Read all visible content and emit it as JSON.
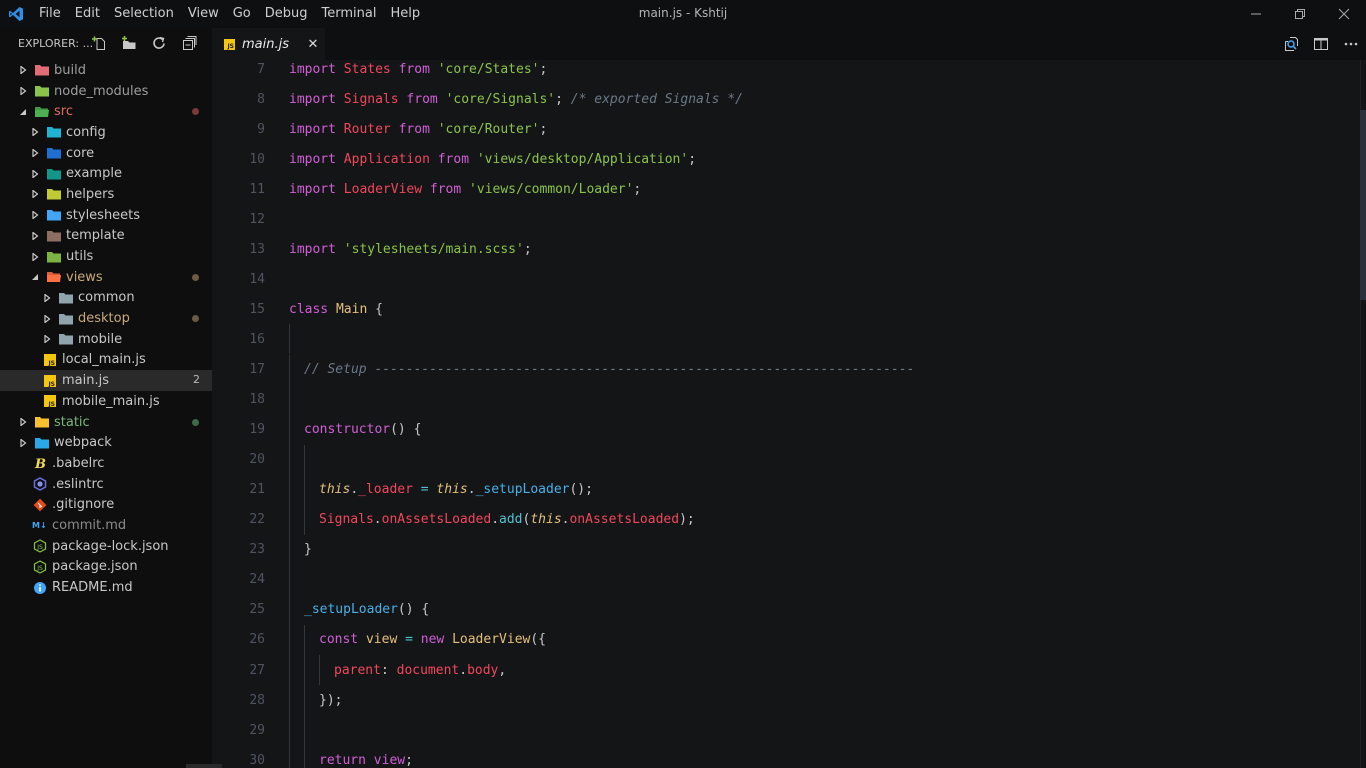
{
  "window": {
    "title": "main.js - Kshtij",
    "menu": [
      "File",
      "Edit",
      "Selection",
      "View",
      "Go",
      "Debug",
      "Terminal",
      "Help"
    ]
  },
  "sidebar": {
    "title": "EXPLORER: ...",
    "actions": [
      "new-file",
      "new-folder",
      "refresh",
      "collapse-all"
    ],
    "tree": [
      {
        "label": "build",
        "depth": 0,
        "kind": "folder",
        "expanded": false,
        "icon_color": "#e06c75",
        "label_color": "#9e9e9e"
      },
      {
        "label": "node_modules",
        "depth": 0,
        "kind": "folder",
        "expanded": false,
        "icon_color": "#8bc34a",
        "label_color": "#9e9e9e"
      },
      {
        "label": "src",
        "depth": 0,
        "kind": "folder",
        "expanded": true,
        "icon_color": "#4caf50",
        "label_color": "#e36a5e",
        "badge_color": "#7a3b38"
      },
      {
        "label": "config",
        "depth": 1,
        "kind": "folder",
        "expanded": false,
        "icon_color": "#1eb3cf"
      },
      {
        "label": "core",
        "depth": 1,
        "kind": "folder",
        "expanded": false,
        "icon_color": "#1e6fd0"
      },
      {
        "label": "example",
        "depth": 1,
        "kind": "folder",
        "expanded": false,
        "icon_color": "#13968a"
      },
      {
        "label": "helpers",
        "depth": 1,
        "kind": "folder",
        "expanded": false,
        "icon_color": "#c0ca33"
      },
      {
        "label": "stylesheets",
        "depth": 1,
        "kind": "folder",
        "expanded": false,
        "icon_color": "#42a5f5"
      },
      {
        "label": "template",
        "depth": 1,
        "kind": "folder",
        "expanded": false,
        "icon_color": "#8d6e63"
      },
      {
        "label": "utils",
        "depth": 1,
        "kind": "folder",
        "expanded": false,
        "icon_color": "#7cb342"
      },
      {
        "label": "views",
        "depth": 1,
        "kind": "folder",
        "expanded": true,
        "icon_color": "#ff7043",
        "label_color": "#c9a97c",
        "badge_color": "#6b5a44"
      },
      {
        "label": "common",
        "depth": 2,
        "kind": "folder",
        "expanded": false,
        "icon_color": "#90a4ae"
      },
      {
        "label": "desktop",
        "depth": 2,
        "kind": "folder",
        "expanded": false,
        "icon_color": "#90a4ae",
        "label_color": "#c9a97c",
        "badge_color": "#6b5a44"
      },
      {
        "label": "mobile",
        "depth": 2,
        "kind": "folder",
        "expanded": false,
        "icon_color": "#90a4ae"
      },
      {
        "label": "local_main.js",
        "depth": 1,
        "kind": "js"
      },
      {
        "label": "main.js",
        "depth": 1,
        "kind": "js",
        "selected": true,
        "badge_text": "2"
      },
      {
        "label": "mobile_main.js",
        "depth": 1,
        "kind": "js"
      },
      {
        "label": "static",
        "depth": 0,
        "kind": "folder",
        "expanded": false,
        "icon_color": "#fbc02d",
        "label_color": "#79b77a",
        "badge_color": "#3c6b49"
      },
      {
        "label": "webpack",
        "depth": 0,
        "kind": "folder",
        "expanded": false,
        "icon_color": "#29a7e6"
      },
      {
        "label": ".babelrc",
        "depth": 0,
        "kind": "babel"
      },
      {
        "label": ".eslintrc",
        "depth": 0,
        "kind": "eslint"
      },
      {
        "label": ".gitignore",
        "depth": 0,
        "kind": "git"
      },
      {
        "label": "commit.md",
        "depth": 0,
        "kind": "markdown",
        "label_color": "#8a8a8a"
      },
      {
        "label": "package-lock.json",
        "depth": 0,
        "kind": "node"
      },
      {
        "label": "package.json",
        "depth": 0,
        "kind": "node"
      },
      {
        "label": "README.md",
        "depth": 0,
        "kind": "info"
      }
    ]
  },
  "tabs": [
    {
      "label": "main.js",
      "active": true,
      "icon_text": "JS"
    }
  ],
  "editor": {
    "lines": [
      {
        "n": "7",
        "indent": 0,
        "tokens": [
          [
            "kw",
            "import"
          ],
          [
            "pn",
            " "
          ],
          [
            "cls",
            "States"
          ],
          [
            "pn",
            " "
          ],
          [
            "kw",
            "from"
          ],
          [
            "pn",
            " "
          ],
          [
            "str",
            "'core/States'"
          ],
          [
            "pn",
            ";"
          ]
        ]
      },
      {
        "n": "8",
        "indent": 0,
        "tokens": [
          [
            "kw",
            "import"
          ],
          [
            "pn",
            " "
          ],
          [
            "cls",
            "Signals"
          ],
          [
            "pn",
            " "
          ],
          [
            "kw",
            "from"
          ],
          [
            "pn",
            " "
          ],
          [
            "str",
            "'core/Signals'"
          ],
          [
            "pn",
            "; "
          ],
          [
            "cmt",
            "/* exported Signals */"
          ]
        ]
      },
      {
        "n": "9",
        "indent": 0,
        "tokens": [
          [
            "kw",
            "import"
          ],
          [
            "pn",
            " "
          ],
          [
            "cls",
            "Router"
          ],
          [
            "pn",
            " "
          ],
          [
            "kw",
            "from"
          ],
          [
            "pn",
            " "
          ],
          [
            "str",
            "'core/Router'"
          ],
          [
            "pn",
            ";"
          ]
        ]
      },
      {
        "n": "10",
        "indent": 0,
        "tokens": [
          [
            "kw",
            "import"
          ],
          [
            "pn",
            " "
          ],
          [
            "cls",
            "Application"
          ],
          [
            "pn",
            " "
          ],
          [
            "kw",
            "from"
          ],
          [
            "pn",
            " "
          ],
          [
            "str",
            "'views/desktop/Application'"
          ],
          [
            "pn",
            ";"
          ]
        ]
      },
      {
        "n": "11",
        "indent": 0,
        "tokens": [
          [
            "kw",
            "import"
          ],
          [
            "pn",
            " "
          ],
          [
            "cls",
            "LoaderView"
          ],
          [
            "pn",
            " "
          ],
          [
            "kw",
            "from"
          ],
          [
            "pn",
            " "
          ],
          [
            "str",
            "'views/common/Loader'"
          ],
          [
            "pn",
            ";"
          ]
        ]
      },
      {
        "n": "12",
        "indent": 0,
        "tokens": []
      },
      {
        "n": "13",
        "indent": 0,
        "tokens": [
          [
            "kw",
            "import"
          ],
          [
            "pn",
            " "
          ],
          [
            "str",
            "'stylesheets/main.scss'"
          ],
          [
            "pn",
            ";"
          ]
        ]
      },
      {
        "n": "14",
        "indent": 0,
        "tokens": []
      },
      {
        "n": "15",
        "indent": 0,
        "tokens": [
          [
            "kw",
            "class"
          ],
          [
            "pn",
            " "
          ],
          [
            "tys",
            "Main"
          ],
          [
            "pn",
            " {"
          ]
        ]
      },
      {
        "n": "16",
        "indent": 1,
        "tokens": []
      },
      {
        "n": "17",
        "indent": 1,
        "tokens": [
          [
            "cmt",
            "// Setup ---------------------------------------------------------------------"
          ]
        ]
      },
      {
        "n": "18",
        "indent": 1,
        "tokens": []
      },
      {
        "n": "19",
        "indent": 1,
        "tokens": [
          [
            "kw",
            "constructor"
          ],
          [
            "pn",
            "() {"
          ]
        ]
      },
      {
        "n": "20",
        "indent": 2,
        "tokens": []
      },
      {
        "n": "21",
        "indent": 2,
        "tokens": [
          [
            "thisk",
            "this"
          ],
          [
            "pn",
            "."
          ],
          [
            "prop",
            "_loader"
          ],
          [
            "pn",
            " "
          ],
          [
            "op",
            "="
          ],
          [
            "pn",
            " "
          ],
          [
            "thisk",
            "this"
          ],
          [
            "pn",
            "."
          ],
          [
            "fn",
            "_setupLoader"
          ],
          [
            "pn",
            "();"
          ]
        ]
      },
      {
        "n": "22",
        "indent": 2,
        "tokens": [
          [
            "cls",
            "Signals"
          ],
          [
            "pn",
            "."
          ],
          [
            "prop",
            "onAssetsLoaded"
          ],
          [
            "pn",
            "."
          ],
          [
            "cyan",
            "add"
          ],
          [
            "pn",
            "("
          ],
          [
            "thisk",
            "this"
          ],
          [
            "pn",
            "."
          ],
          [
            "prop",
            "onAssetsLoaded"
          ],
          [
            "pn",
            ");"
          ]
        ]
      },
      {
        "n": "23",
        "indent": 1,
        "tokens": [
          [
            "pn",
            "}"
          ]
        ]
      },
      {
        "n": "24",
        "indent": 1,
        "tokens": []
      },
      {
        "n": "25",
        "indent": 1,
        "tokens": [
          [
            "fn",
            "_setupLoader"
          ],
          [
            "pn",
            "() {"
          ]
        ]
      },
      {
        "n": "26",
        "indent": 2,
        "tokens": [
          [
            "kw",
            "const"
          ],
          [
            "pn",
            " "
          ],
          [
            "var",
            "view"
          ],
          [
            "pn",
            " "
          ],
          [
            "op",
            "="
          ],
          [
            "pn",
            " "
          ],
          [
            "kw",
            "new"
          ],
          [
            "pn",
            " "
          ],
          [
            "tys",
            "LoaderView"
          ],
          [
            "pn",
            "({"
          ]
        ]
      },
      {
        "n": "27",
        "indent": 3,
        "tokens": [
          [
            "prop",
            "parent"
          ],
          [
            "pn",
            ": "
          ],
          [
            "prop",
            "document"
          ],
          [
            "pn",
            "."
          ],
          [
            "prop",
            "body"
          ],
          [
            "pn",
            ","
          ]
        ]
      },
      {
        "n": "28",
        "indent": 2,
        "tokens": [
          [
            "pn",
            "});"
          ]
        ]
      },
      {
        "n": "29",
        "indent": 2,
        "tokens": []
      },
      {
        "n": "30",
        "indent": 2,
        "tokens": [
          [
            "kw",
            "return"
          ],
          [
            "pn",
            " "
          ],
          [
            "kw",
            "view"
          ],
          [
            "pn",
            ";"
          ]
        ]
      }
    ]
  },
  "colors": {
    "accent": "#007acc",
    "editor_bg": "#141517",
    "sidebar_bg": "#0e0e0e"
  }
}
